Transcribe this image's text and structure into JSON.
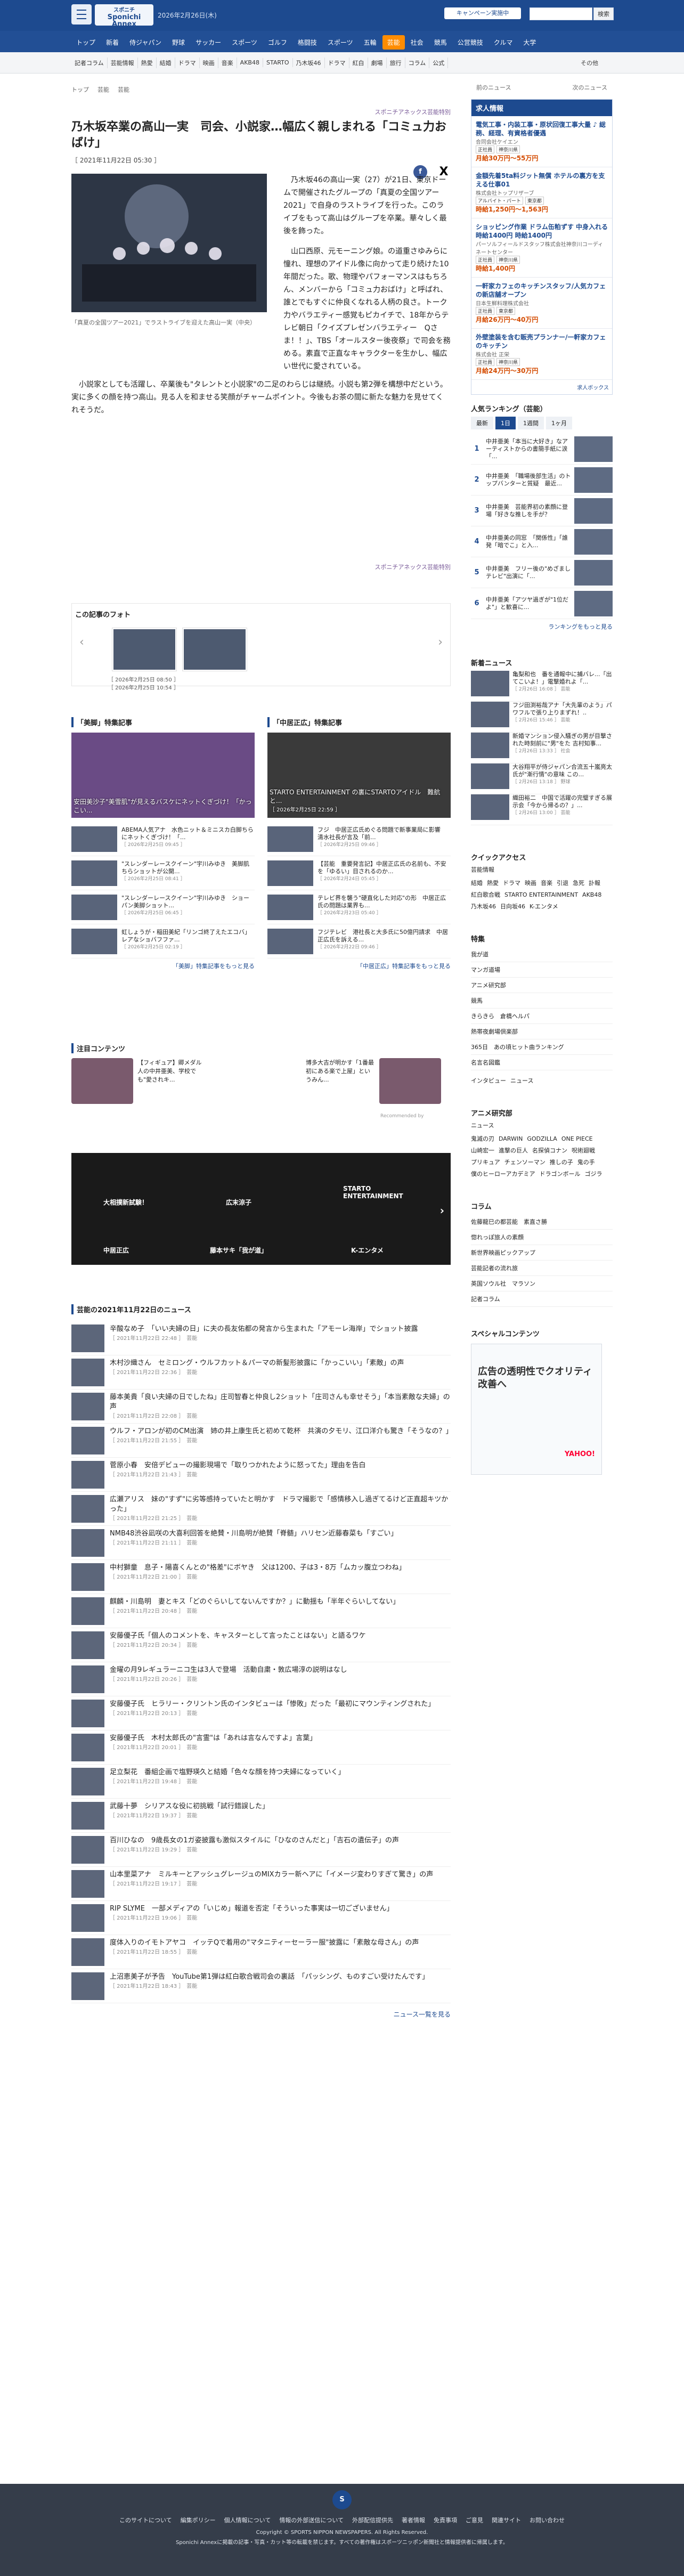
{
  "header": {
    "logo_top": "スポニチ",
    "logo_main": "Sponichi Annex",
    "date_text": "2026年2月26日(木)",
    "campaign_label": "キャンペーン実施中",
    "search_placeholder": "",
    "search_button": "検索"
  },
  "global_nav": [
    "トップ",
    "新着",
    "侍ジャパン",
    "野球",
    "サッカー",
    "スポーツ",
    "ゴルフ",
    "格闘技",
    "スポーツ",
    "五輪",
    "芸能",
    "社会",
    "競馬",
    "公営競技",
    "クルマ",
    "大学"
  ],
  "sub_nav": [
    "記者コラム",
    "芸能情報",
    "熱愛",
    "結婚",
    "ドラマ",
    "映画",
    "音楽",
    "AKB48",
    "STARTO",
    "乃木坂46",
    "ドラマ",
    "紅白",
    "劇場",
    "旅行",
    "コラム",
    "公式"
  ],
  "sub_nav_more": "その他",
  "breadcrumb": [
    "トップ",
    "芸能",
    "芸能"
  ],
  "article": {
    "credit": "スポニチアネックス芸能特別",
    "title": "乃木坂卒業の高山一実　司会、小説家…幅広く親しまれる「コミュ力おばけ」",
    "date": "［ 2021年11月22日 05:30 ］",
    "share_fb": "f",
    "share_x": "X",
    "hero_caption": "「真夏の全国ツアー2021」でラストライブを迎えた高山一実（中央）",
    "p1": "乃木坂46の高山一実（27）が21日、東京ドームで開催されたグループの「真夏の全国ツアー2021」で自身のラストライブを行った。このライブをもって高山はグループを卒業。華々しく最後を飾った。",
    "p2": "山口西原、元モーニング娘。の道重さゆみらに憧れ、理想のアイドル像に向かって走り続けた10年間だった。歌、物理やパフォーマンスはもちろん、メンバーから「コミュ力おばけ」と呼ばれ、誰とでもすぐに仲良くなれる人柄の良さ。トーク力やバラエティー感覚もピカイチで、18年からテレビ朝日「クイズプレゼンバラエティー　Qさま！！」、TBS「オールスター後夜祭」で司会を務める。素直で正直なキャラクターを生かし、幅広い世代に愛されている。",
    "p3": "小説家としても活躍し、卒業後も\"タレントと小説家\"の二足のわらじは継続。小説も第2弾を構想中だという。実に多くの顔を持つ高山。見る人を和ませる笑顔がチャームポイント。今後もお茶の間に新たな魅力を見せてくれそうだ。",
    "credit_bottom": "スポニチアネックス芸能特別"
  },
  "photos": {
    "header": "この記事のフォト",
    "dates": [
      "［ 2026年2月25日 08:50 ］",
      "［ 2026年2月25日 10:54 ］"
    ]
  },
  "features": {
    "left": {
      "header": "「美脚」特集記事",
      "lead": "安田美沙子\"美雪肌\"が見えるバスケにネットくぎづけ！「かっこい...",
      "items": [
        {
          "t": "ABEMA人気アナ　水色ニット＆ミニスカ白脚ちらにネットくぎづけ！「...",
          "d": "［ 2026年2月25日 09:45 ］"
        },
        {
          "t": "\"スレンダーレースクイーン\"宇川みゆき　美脚肌ちらショットが公開...",
          "d": "［ 2026年2月25日 08:41 ］"
        },
        {
          "t": "\"スレンダーレースクイーン\"宇川みゆき　ショーパン美脚ショット...",
          "d": "［ 2026年2月25日 06:45 ］"
        },
        {
          "t": "虹しょうが・稲田美紀「リンゴ終了えたエコバ」レアなショバフファ...",
          "d": "［ 2026年2月25日 02:19 ］"
        }
      ],
      "more": "「美脚」特集記事をもっと見る"
    },
    "right": {
      "header": "「中居正広」特集記事",
      "lead": "STARTO ENTERTAINMENT の裏にSTARTOアイドル　難航と...",
      "lead_date": "［ 2026年2月25日 22:59 ］",
      "items": [
        {
          "t": "フジ　中居正広氏めぐる問題で新事業局に影響　清水社長が言及「前...",
          "d": "［ 2026年2月25日 09:46 ］"
        },
        {
          "t": "【芸能　重要発言記】中居正広氏の名前も、不安を「ゆるい」目されるのか...",
          "d": "［ 2026年2月24日 05:45 ］"
        },
        {
          "t": "テレビ界を襲う\"硬直化した対応\"の形　中居正広氏の問題は業界も...",
          "d": "［ 2026年2月23日 05:40 ］"
        },
        {
          "t": "フジテレビ　港社長と大多氏に50億円請求　中居正広氏を訴える...",
          "d": "［ 2026年2月22日 09:46 ］"
        }
      ],
      "more": "「中居正広」特集記事をもっと見る"
    }
  },
  "attention": {
    "header": "注目コンテンツ",
    "a1": "【フィギュア】卿メダル人の中井亜美、学校でも\"愛されキ...",
    "a2": "博多大吉が明かす「1番最初にある楽で上屋」というみん...",
    "provider": "Recommended by"
  },
  "banner": {
    "b1": "大相撲新試験！",
    "b2": "広末涼子",
    "b3": "STARTO ENTERTAINMENT",
    "b4": "中居正広",
    "b5": "藤本サキ「我が道」",
    "b6": "K-エンタメ"
  },
  "news": {
    "header": "芸能の2021年11月22日のニュース",
    "items": [
      {
        "t": "辛酸なめ子　「いい夫婦の日」に夫の長友佑都の発言から生まれた「アモーレ海岸」でショット披露",
        "d": "［ 2021年11月22日 22:48 ］　芸能"
      },
      {
        "t": "木村沙織さん　セミロング・ウルフカット＆パーマの新髪形披露に「かっこいい」「素敵」の声",
        "d": "［ 2021年11月22日 22:36 ］　芸能"
      },
      {
        "t": "藤本美貴「良い夫婦の日でしたね」庄司智春と仲良し2ショット「庄司さんも幸せそう」「本当素敵な夫婦」の声",
        "d": "［ 2021年11月22日 22:08 ］　芸能"
      },
      {
        "t": "ウルフ・アロンが初のCM出演　姉の井上康生氏と初めて乾杯　共演の夕モリ、江口洋介も驚き「そうなの？」",
        "d": "［ 2021年11月22日 21:55 ］　芸能"
      },
      {
        "t": "菅原小春　安倍デビューの撮影現場で「取りつかれたように怒ってた」理由を告白",
        "d": "［ 2021年11月22日 21:43 ］　芸能"
      },
      {
        "t": "広瀬アリス　妹の\"すず\"に劣等感持っていたと明かす　ドラマ撮影で「感情移入し過ぎてるけど正直超キツかった」",
        "d": "［ 2021年11月22日 21:25 ］　芸能"
      },
      {
        "t": "NMB48渋谷凪咲の大喜利回答を絶賛・川島明が絶賛「脊髄」ハリセン近藤春菜も「すごい」",
        "d": "［ 2021年11月22日 21:11 ］　芸能"
      },
      {
        "t": "中村獅童　息子・陽喜くんとの\"格差\"にボヤき　父は1200、子は3・8万「ムカッ腹立つわね」",
        "d": "［ 2021年11月22日 21:00 ］　芸能"
      },
      {
        "t": "麒麟・川島明　妻とキス「どのぐらいしてないんですか？」に動揺も「半年ぐらいしてない」",
        "d": "［ 2021年11月22日 20:48 ］　芸能"
      },
      {
        "t": "安藤優子氏「個人のコメントを、キャスターとして言ったことはない」と語るワケ",
        "d": "［ 2021年11月22日 20:34 ］　芸能"
      },
      {
        "t": "金曜の月9レギュラーニコ生は3人で登場　活動自粛・敦広場淳の説明はなし",
        "d": "［ 2021年11月22日 20:26 ］　芸能"
      },
      {
        "t": "安藤優子氏　ヒラリー・クリントン氏のインタビューは「惨敗」だった「最初にマウンティングされた」",
        "d": "［ 2021年11月22日 20:13 ］　芸能"
      },
      {
        "t": "安藤優子氏　木村太郎氏の\"言霊\"は「あれは言なんですよ」言葉」",
        "d": "［ 2021年11月22日 20:01 ］　芸能"
      },
      {
        "t": "足立梨花　番組企画で塩野瑛久と結婚「色々な顔を持つ夫婦になっていく」",
        "d": "［ 2021年11月22日 19:48 ］　芸能"
      },
      {
        "t": "武藤十夢　シリアスな役に初挑戦「試行錯誤した」",
        "d": "［ 2021年11月22日 19:37 ］　芸能"
      },
      {
        "t": "百川ひなの　9歳長女の1ガ姿披露も激似スタイルに「ひなのさんだと」「吉石の遺伝子」の声",
        "d": "［ 2021年11月22日 19:29 ］　芸能"
      },
      {
        "t": "山本里菜アナ　ミルキーとアッシュグレージュのMIXカラー新ヘアに「イメージ変わりすぎて驚き」の声",
        "d": "［ 2021年11月22日 19:17 ］　芸能"
      },
      {
        "t": "RIP SLYME　一部メディアの「いじめ」報道を否定「そういった事実は一切ございません」",
        "d": "［ 2021年11月22日 19:06 ］　芸能"
      },
      {
        "t": "度体入りのイモトアヤコ　イッテQで着用の\"マタニティーセーラー服\"披露に「素敵な母さん」の声",
        "d": "［ 2021年11月22日 18:55 ］　芸能"
      },
      {
        "t": "上沼恵美子が予告　YouTube第1弾は紅白歌合戦司会の裏話　「パッシング、ものすごい受けたんです」",
        "d": "［ 2021年11月22日 18:43 ］　芸能"
      }
    ],
    "more": "ニュース一覧を見る"
  },
  "sidebar": {
    "topbar_prev": "前のニュース",
    "topbar_next": "次のニュース",
    "jobs_header": "求人情報",
    "jobs": [
      {
        "t": "電気工事・内装工事・原状回復工事大量 ♪ 総務、経理、有資格者優遇",
        "co": "合同会社ケイエン",
        "tags": [
          "正社員",
          "神奈川県"
        ],
        "pay": "月給30万円〜55万円"
      },
      {
        "t": "金額先着5ta料ジット無償 ホテルの裏方を支える仕事01",
        "co": "株式会社トップリザーブ",
        "tags": [
          "アルバイト・パート",
          "東京都"
        ],
        "pay": "時給1,250円〜1,563円"
      },
      {
        "t": "ショッピング作業 ドラム缶粕ずす 中身入れる 時給1400円 時給1400円",
        "co": "パーソルフィールドスタッフ株式会社神奈川コーディネートセンター",
        "tags": [
          "正社員",
          "神奈川県"
        ],
        "pay": "時給1,400円"
      },
      {
        "t": "一軒家カフェのキッチンスタッフ/人気カフェの新店舗オープン",
        "co": "日本生鮮料理株式会社",
        "tags": [
          "正社員",
          "東京都"
        ],
        "pay": "月給26万円〜40万円"
      },
      {
        "t": "外壁塗装を含む販売プランナー/一軒家カフェのキッチン",
        "co": "株式会社 正栄",
        "tags": [
          "正社員",
          "神奈川県"
        ],
        "pay": "月給24万円〜30万円"
      }
    ],
    "jobs_more": "求人ボックス",
    "ranking_header": "人気ランキング（芸能）",
    "rank_tabs": [
      "最新",
      "1日",
      "1週間",
      "1ヶ月"
    ],
    "ranking": [
      {
        "n": "1",
        "t": "中井亜美「本当に大好き」なアーティストからの書簡手紙に涙「..."
      },
      {
        "n": "2",
        "t": "中井亜美　「職場後部生活」のトップバンターと質疑　最近..."
      },
      {
        "n": "3",
        "t": "中井亜美　芸能界初の素顔に登場「好きな推しを手が？"
      },
      {
        "n": "4",
        "t": "中井亜美の同窓　「関係性」「誰発「暗でこ」と入..."
      },
      {
        "n": "5",
        "t": "中井亜美　フリー後の\"めざましテレビ\"出演に「..."
      },
      {
        "n": "6",
        "t": "中井亜美「アツヤ過ぎが\"1位だよ\"」と歓喜に..."
      }
    ],
    "ranking_more": "ランキングをもっと見る",
    "latest_header": "新着ニュース",
    "latest": [
      {
        "t": "亀梨和也　番を通報中に捕バレ...「出てこいよ！」電撃婚れよ「...",
        "d": "［ 2月26日 16:08 ］ 芸能"
      },
      {
        "t": "フジ田渕裕哉アナ「大先輩のよう」パワフルで張り上りまずれ！..",
        "d": "［ 2月26日 15:46 ］ 芸能"
      },
      {
        "t": "新婚マンション侵入騒ぎの男が目撃された時刻前に\"男\"をた 吉村知事...",
        "d": "［ 2月26日 13:33 ］ 社会"
      },
      {
        "t": "大谷翔平が侍ジャパン合流五十嵐亮太氏が\"漸行情\"の意味 この...",
        "d": "［ 2月26日 13:18 ］ 野球"
      },
      {
        "t": "織田裕二　中国で活躍の完璧すぎる展示会「今から帰るの？」...",
        "d": "［ 2月26日 13:00 ］ 芸能"
      }
    ],
    "quick_header": "クイックアクセス",
    "quick_sub": "芸能情報",
    "quick_links": [
      "結婚",
      "熱愛",
      "ドラマ",
      "映画",
      "音楽",
      "引退",
      "急死",
      "訃報",
      "紅白歌合戦",
      "STARTO ENTERTAINMENT",
      "AKB48",
      "乃木坂46",
      "日向坂46",
      "K-エンタメ"
    ],
    "special_header": "特集",
    "special": [
      "我が道",
      "マンガ道場",
      "アニメ研究部",
      "競馬",
      "きらきら　倉橋ヘルパ",
      "熱帯夜劇場倶楽部",
      "365日　あの頃ヒット曲ランキング",
      "名言名図鑑"
    ],
    "special_sub": [
      "インタビュー",
      "ニュース"
    ],
    "anime_header": "アニメ研究部",
    "anime_sub": "ニュース",
    "anime_tags": [
      "鬼滅の刃",
      "DARWIN",
      "GODZILLA",
      "ONE PIECE",
      "山崎宏一",
      "進撃の巨人",
      "名探偵コナン",
      "呪術廻戦",
      "プリキュア",
      "チェンソーマン",
      "推しの子",
      "鬼の手",
      "僕のヒーローアカデミア",
      "ドラゴンボール",
      "ゴジラ"
    ],
    "column_header": "コラム",
    "column": [
      "佐藤龍巳の都芸能　素直さ勝",
      "惚れっぽ旅人の素顔",
      "新世界映画ピックアップ",
      "芸能記者の流れ旅",
      "英国ソウル社　マラソン",
      "記者コラム"
    ],
    "special_contents_header": "スペシャルコンテンツ",
    "ad_title": "広告の透明性でクオリティ改善へ",
    "ad_brand": "YAHOO!"
  },
  "footer": {
    "links": [
      "このサイトについて",
      "編集ポリシー",
      "個人情報について",
      "情報の外部送信について",
      "外部配信提供先",
      "著者情報",
      "免責事項",
      "ご意見",
      "関連サイト",
      "お問い合わせ"
    ],
    "copyright": "Copyright © SPORTS NIPPON NEWSPAPERS. All Rights Reserved.",
    "note": "Sponichi Annexに掲載の記事・写真・カット等の転載を禁じます。すべての著作権はスポーツニッポン新聞社と情報提供者に帰属します。"
  }
}
